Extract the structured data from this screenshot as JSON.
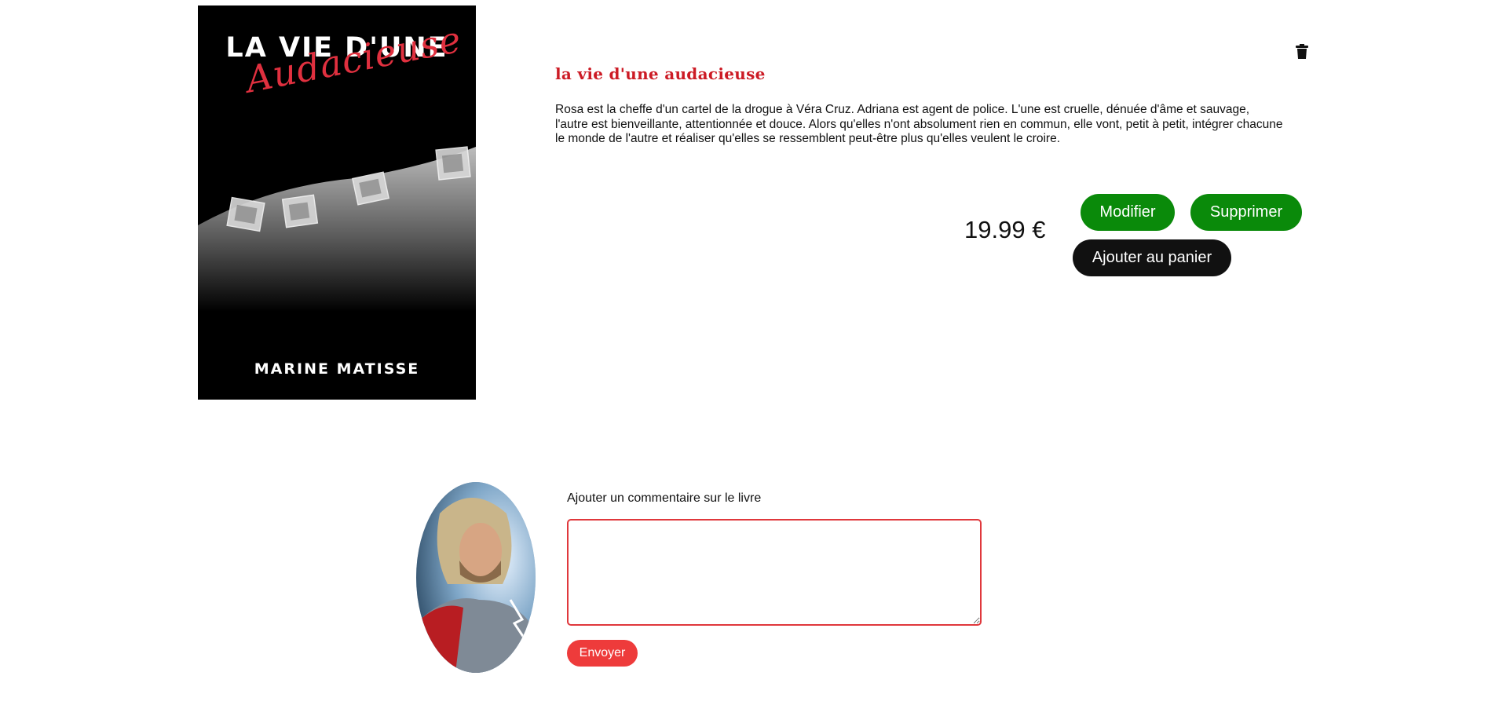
{
  "book": {
    "cover": {
      "title_line": "LA VIE D'UNE",
      "title_script": "Audacieuse",
      "author": "MARINE MATISSE"
    },
    "title": "la vie d'une audacieuse",
    "description": "Rosa est la cheffe d'un cartel de la drogue à Véra Cruz. Adriana est agent de police. L'une est cruelle, dénuée d'âme et sauvage, l'autre est bienveillante, attentionnée et douce. Alors qu'elles n'ont absolument rien en commun, elle vont, petit à petit, intégrer chacune le monde de l'autre et réaliser qu'elles se ressemblent peut-être plus qu'elles veulent le croire.",
    "price": "19.99 €"
  },
  "actions": {
    "modify_label": "Modifier",
    "delete_label": "Supprimer",
    "add_to_cart_label": "Ajouter au panier"
  },
  "icons": {
    "trash": "trash-icon"
  },
  "comments": {
    "label": "Ajouter un commentaire sur le livre",
    "input_value": "",
    "send_label": "Envoyer"
  },
  "colors": {
    "title_red": "#cc1b25",
    "button_green": "#0a8a0a",
    "button_black": "#111111",
    "send_red": "#ee3b3b",
    "input_border": "#e0383c"
  }
}
